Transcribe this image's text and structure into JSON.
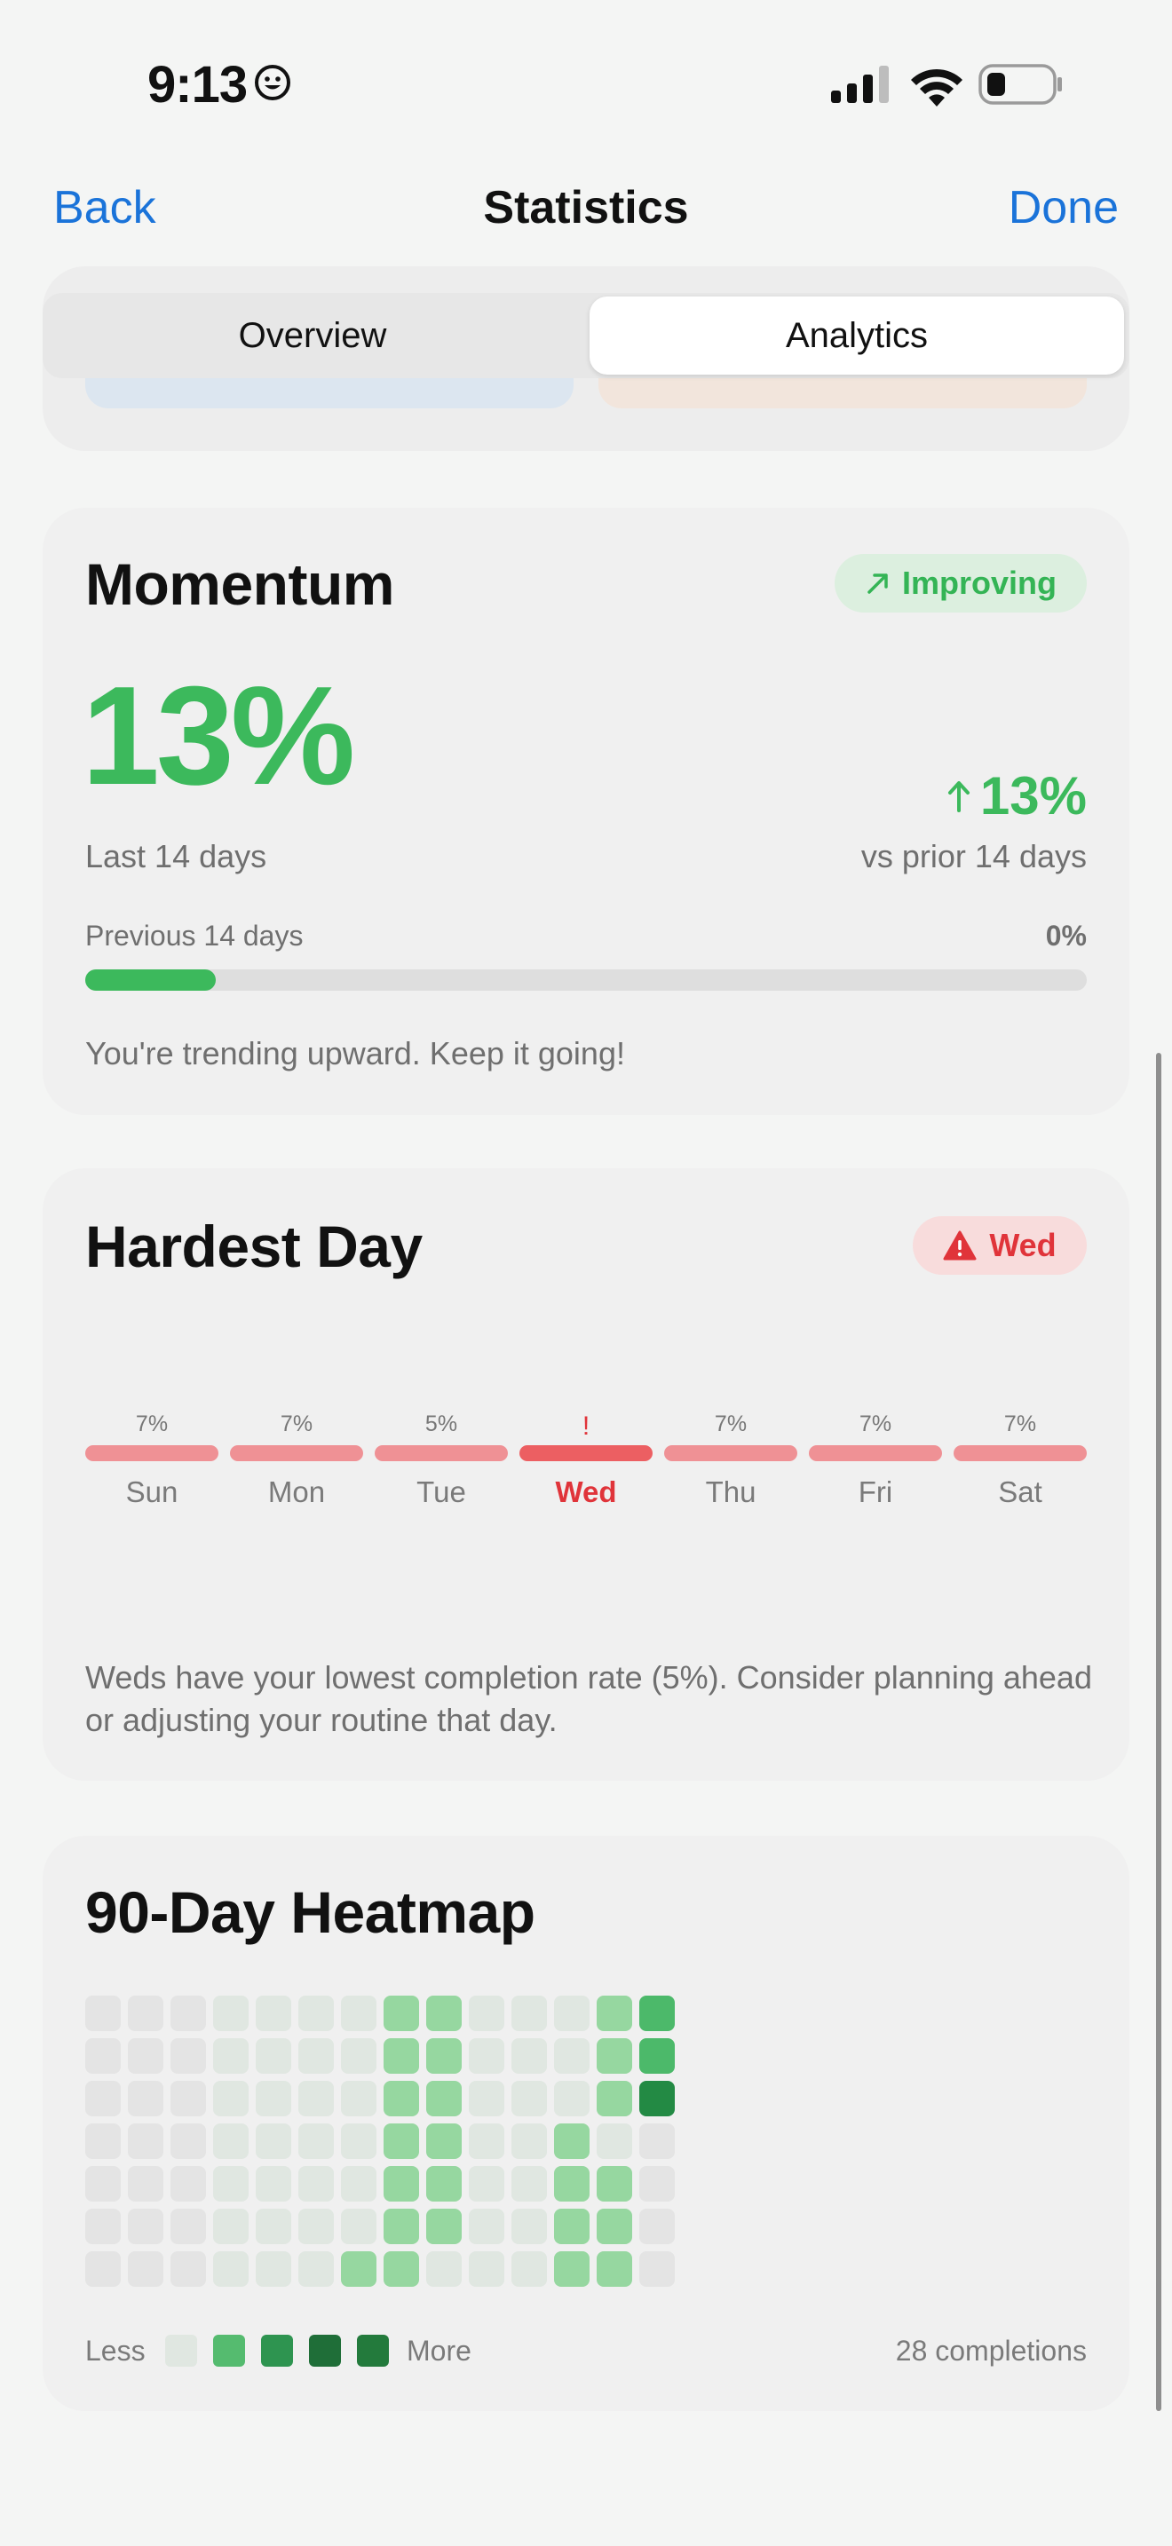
{
  "status_bar": {
    "time": "9:13"
  },
  "nav": {
    "back": "Back",
    "title": "Statistics",
    "done": "Done"
  },
  "segments": [
    "Overview",
    "Analytics"
  ],
  "momentum": {
    "title": "Momentum",
    "badge": "Improving",
    "value": "13%",
    "period": "Last 14 days",
    "delta": "13%",
    "delta_label": "vs prior 14 days",
    "previous_label": "Previous 14 days",
    "previous_value": "0%",
    "progress_fraction": 0.13,
    "note": "You're trending upward. Keep it going!"
  },
  "hardest_day": {
    "title": "Hardest Day",
    "badge": "Wed",
    "days": [
      {
        "name": "Sun",
        "pct": "7%",
        "highlight": false
      },
      {
        "name": "Mon",
        "pct": "7%",
        "highlight": false
      },
      {
        "name": "Tue",
        "pct": "5%",
        "highlight": false
      },
      {
        "name": "Wed",
        "pct": "!",
        "highlight": true
      },
      {
        "name": "Thu",
        "pct": "7%",
        "highlight": false
      },
      {
        "name": "Fri",
        "pct": "7%",
        "highlight": false
      },
      {
        "name": "Sat",
        "pct": "7%",
        "highlight": false
      }
    ],
    "note": "Weds have your lowest completion rate (5%). Consider planning ahead or adjusting your routine that day."
  },
  "heatmap": {
    "title": "90-Day Heatmap",
    "rows": [
      [
        0,
        0,
        0,
        1,
        1,
        1,
        1,
        2,
        2,
        1,
        1,
        1,
        2,
        3
      ],
      [
        0,
        0,
        0,
        1,
        1,
        1,
        1,
        2,
        2,
        1,
        1,
        1,
        2,
        3
      ],
      [
        0,
        0,
        0,
        1,
        1,
        1,
        1,
        2,
        2,
        1,
        1,
        1,
        2,
        4
      ],
      [
        0,
        0,
        0,
        1,
        1,
        1,
        1,
        2,
        2,
        1,
        1,
        2,
        1,
        0
      ],
      [
        0,
        0,
        0,
        1,
        1,
        1,
        1,
        2,
        2,
        1,
        1,
        2,
        2,
        0
      ],
      [
        0,
        0,
        0,
        1,
        1,
        1,
        1,
        2,
        2,
        1,
        1,
        2,
        2,
        0
      ],
      [
        0,
        0,
        0,
        1,
        1,
        1,
        2,
        2,
        1,
        1,
        1,
        2,
        2,
        0
      ]
    ],
    "level_colors": [
      "#e4e4e4",
      "#e0e7e1",
      "#96d7a0",
      "#4cb96a",
      "#238a44"
    ],
    "legend_less": "Less",
    "legend_more": "More",
    "legend_colors": [
      "#e0e7e1",
      "#55bb6f",
      "#2e9450",
      "#1f6e38",
      "#237a3c"
    ],
    "completions": "28 completions"
  },
  "colors": {
    "accent_blue": "#1a73d9",
    "green": "#3cb95c",
    "red": "#e0343a"
  }
}
